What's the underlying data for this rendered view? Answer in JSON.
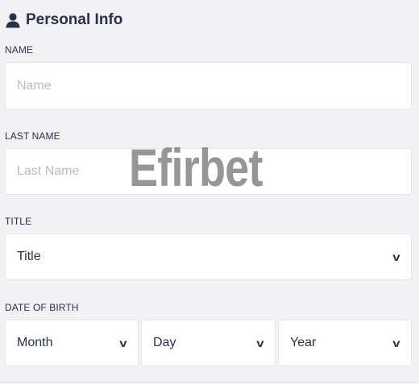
{
  "section": {
    "title": "Personal Info",
    "icon": "person-icon"
  },
  "name": {
    "label": "NAME",
    "placeholder": "Name",
    "value": ""
  },
  "last_name": {
    "label": "LAST NAME",
    "placeholder": "Last Name",
    "value": ""
  },
  "title_field": {
    "label": "TITLE",
    "selected": "Title",
    "chevron": "v"
  },
  "dob": {
    "label": "DATE OF BIRTH",
    "month": "Month",
    "day": "Day",
    "year": "Year",
    "chevron": "v"
  },
  "watermark": "Efirbet",
  "colors": {
    "text": "#2b3147",
    "placeholder": "#b8bcc6",
    "background": "#f2f2f4",
    "field": "#ffffff"
  }
}
